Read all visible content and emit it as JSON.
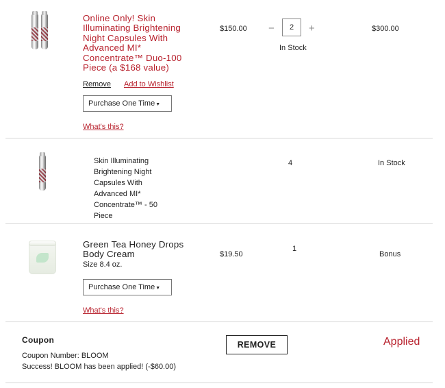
{
  "items": [
    {
      "name": "Online Only! Skin Illuminating Brightening Night Capsules With Advanced MI* Concentrate™ Duo-100 Piece (a $168 value)",
      "name_lines": [
        "Online Only! Skin",
        "Illuminating Brightening",
        "Night Capsules With",
        "Advanced MI*",
        "Concentrate™ Duo-100",
        "Piece (a $168 value)"
      ],
      "price": "$150.00",
      "quantity": "2",
      "minus": "−",
      "plus": "+",
      "stock": "In Stock",
      "total": "$300.00",
      "remove_label": "Remove",
      "wishlist_label": "Add to Wishlist",
      "purchase_option": "Purchase One Time",
      "whats_this": "What's this?",
      "image_icon": "capsule-duo-icon"
    },
    {
      "name_lines": [
        "Skin Illuminating",
        "Brightening Night",
        "Capsules With",
        "Advanced MI*",
        "Concentrate™ - 50",
        "Piece"
      ],
      "quantity": "4",
      "stock": "In Stock",
      "image_icon": "capsule-single-icon"
    },
    {
      "name_lines": [
        "Green Tea Honey Drops",
        "Body Cream"
      ],
      "size": "Size 8.4 oz.",
      "price": "$19.50",
      "quantity": "1",
      "status": "Bonus",
      "purchase_option": "Purchase One Time",
      "whats_this": "What's this?",
      "image_icon": "body-cream-jar-icon"
    }
  ],
  "coupon": {
    "title": "Coupon",
    "number_text": "Coupon Number: BLOOM",
    "success_text": "Success! BLOOM has been applied! (-$60.00)",
    "remove_button": "REMOVE",
    "status": "Applied"
  },
  "colors": {
    "accent_red": "#b8212d",
    "divider": "#d6d6d6",
    "text": "#222222"
  }
}
